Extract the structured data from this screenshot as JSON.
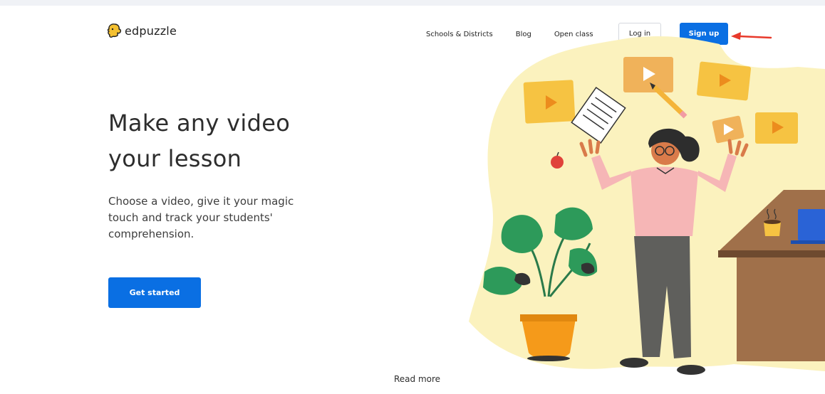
{
  "brand": {
    "name": "edpuzzle",
    "logo_icon": "puzzle-head-icon",
    "accent_color": "#0a6fe3"
  },
  "nav": {
    "links": [
      "Schools & Districts",
      "Blog",
      "Open class"
    ],
    "login_label": "Log in",
    "signup_label": "Sign up"
  },
  "hero": {
    "headline": "Make any video your lesson",
    "subtext": "Choose a video, give it your magic touch and track your students' comprehension.",
    "cta_label": "Get started"
  },
  "footer": {
    "read_more": "Read more"
  }
}
